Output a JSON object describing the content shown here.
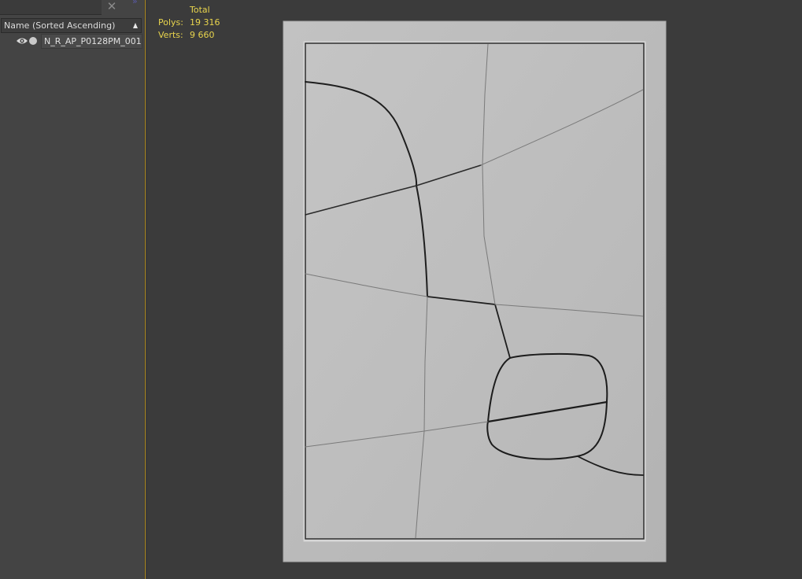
{
  "explorer": {
    "close_icon": "close-icon",
    "column_header": "Name (Sorted Ascending)",
    "sort_icon": "sort-ascending-icon",
    "objects": [
      {
        "name": "N_R_AP_P0128PM_001",
        "visibility_icon": "eye-icon",
        "render_icon": "render-dot-icon"
      }
    ]
  },
  "viewport": {
    "stats": {
      "header": "Total",
      "polys_label": "Polys:",
      "polys_value": "19 316",
      "verts_label": "Verts:",
      "verts_value": "9 660",
      "color": "#e8d44d"
    },
    "colors": {
      "background": "#3b3b3b",
      "panel_outer": "#b9b9b9",
      "panel_inner": "#bdbdbd",
      "accent_splitter": "#b08a1e"
    }
  }
}
